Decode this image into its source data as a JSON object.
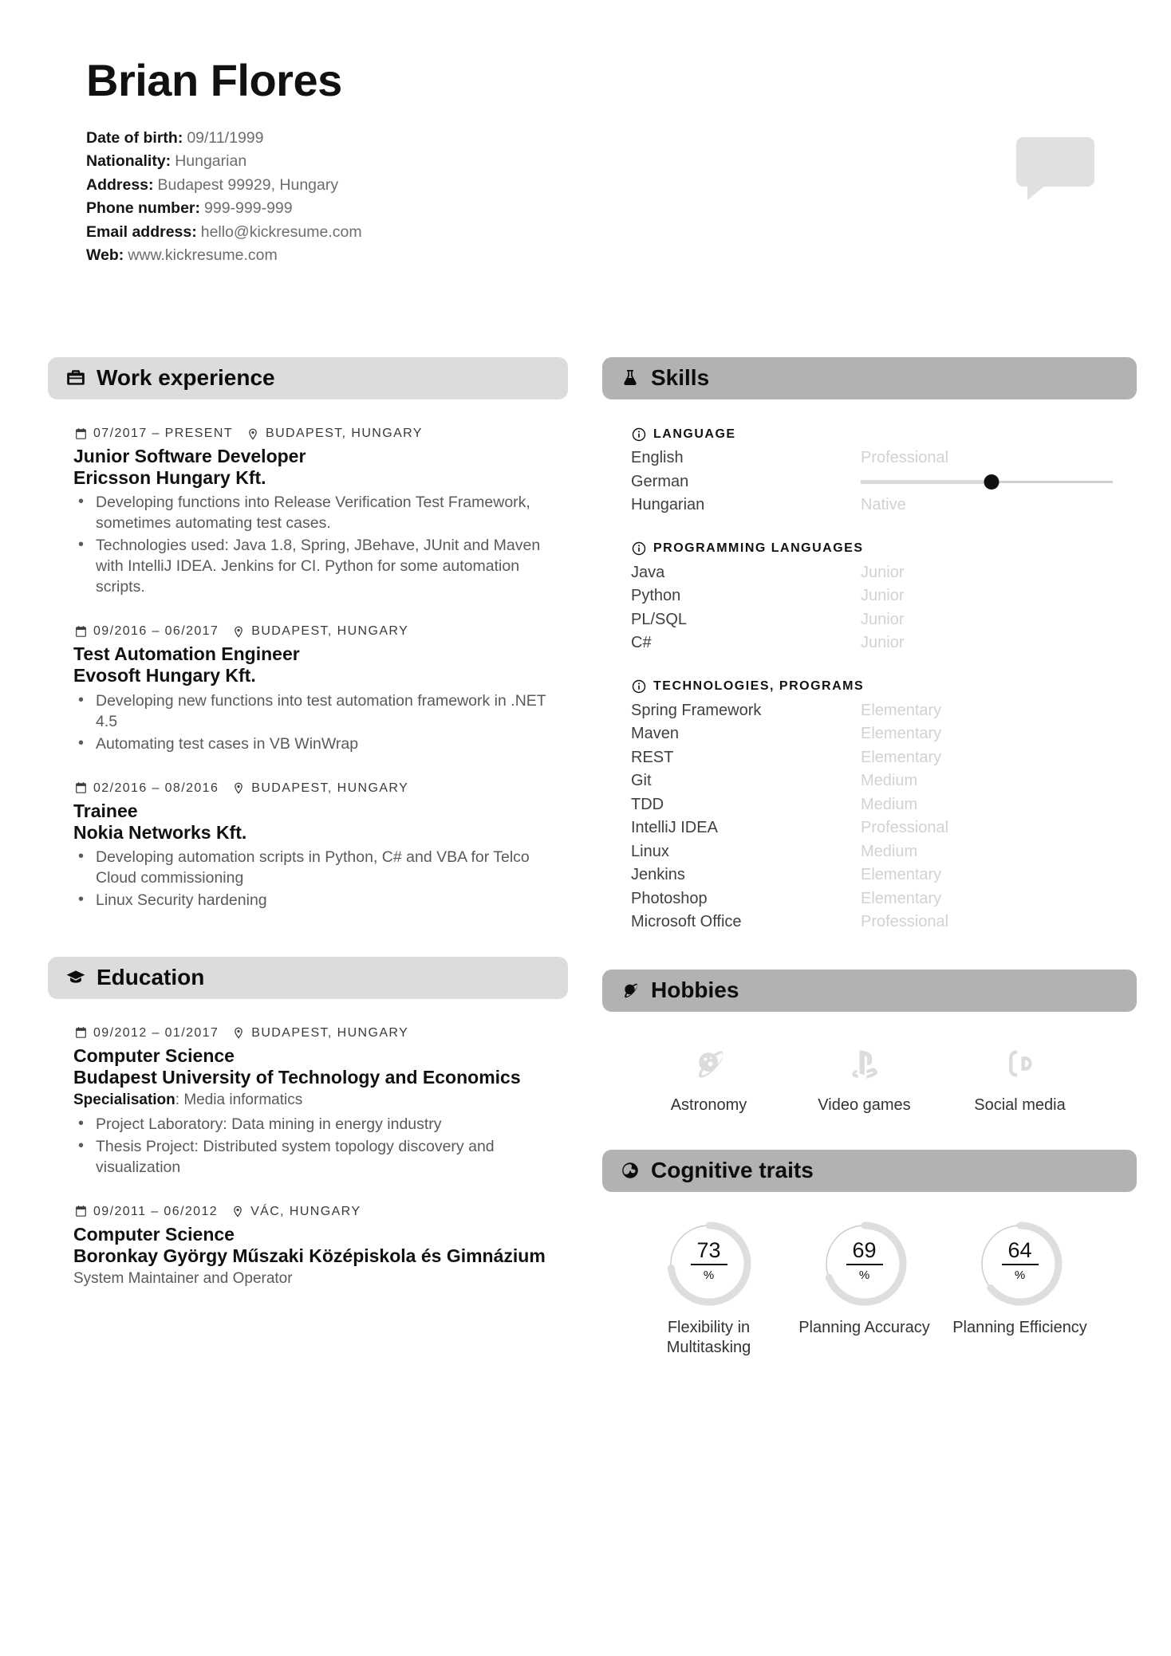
{
  "header": {
    "name": "Brian Flores",
    "contacts": [
      {
        "label": "Date of birth:",
        "value": "09/11/1999"
      },
      {
        "label": "Nationality:",
        "value": "Hungarian"
      },
      {
        "label": "Address:",
        "value": "Budapest 99929, Hungary"
      },
      {
        "label": "Phone number:",
        "value": "999-999-999"
      },
      {
        "label": "Email address:",
        "value": "hello@kickresume.com"
      },
      {
        "label": "Web:",
        "value": "www.kickresume.com"
      }
    ]
  },
  "colors": {
    "section_light": "#dcdcdc",
    "section_dark": "#b2b2b2",
    "level_text": "#d2d2d2",
    "accent_dot": "#111111"
  },
  "work": {
    "title": "Work experience",
    "icon": "briefcase-icon",
    "entries": [
      {
        "dates": "07/2017 – PRESENT",
        "location": "BUDAPEST, HUNGARY",
        "title": "Junior Software Developer",
        "org": "Ericsson Hungary Kft.",
        "bullets": [
          "Developing functions into Release Verification Test Framework, sometimes automating test cases.",
          "Technologies used: Java 1.8, Spring, JBehave, JUnit and Maven with IntelliJ IDEA. Jenkins for CI. Python for some automation scripts."
        ]
      },
      {
        "dates": "09/2016 – 06/2017",
        "location": "BUDAPEST, HUNGARY",
        "title": "Test Automation Engineer",
        "org": "Evosoft Hungary Kft.",
        "bullets": [
          "Developing new functions into test automation framework in .NET 4.5",
          "Automating test cases in VB WinWrap"
        ]
      },
      {
        "dates": "02/2016 – 08/2016",
        "location": "BUDAPEST, HUNGARY",
        "title": "Trainee",
        "org": "Nokia Networks Kft.",
        "bullets": [
          "Developing automation scripts in Python, C# and VBA for Telco Cloud commissioning",
          "Linux Security hardening"
        ]
      }
    ]
  },
  "education": {
    "title": "Education",
    "icon": "graduation-cap-icon",
    "entries": [
      {
        "dates": "09/2012 – 01/2017",
        "location": "BUDAPEST, HUNGARY",
        "title": "Computer Science",
        "org": "Budapest University of Technology and Economics",
        "spec_label": "Specialisation",
        "spec_value": ": Media informatics",
        "bullets": [
          "Project Laboratory: Data mining in energy industry",
          "Thesis Project: Distributed system topology discovery and visualization"
        ]
      },
      {
        "dates": "09/2011 – 06/2012",
        "location": "VÁC, HUNGARY",
        "title": "Computer Science",
        "org": "Boronkay György Műszaki Középiskola és Gimnázium",
        "sub": "System Maintainer and Operator",
        "bullets": []
      }
    ]
  },
  "skills": {
    "title": "Skills",
    "icon": "flask-icon",
    "groups": [
      {
        "name": "LANGUAGE",
        "rows": [
          {
            "name": "English",
            "level": "Professional",
            "slider": null
          },
          {
            "name": "German",
            "level": "",
            "slider": 52
          },
          {
            "name": "Hungarian",
            "level": "Native",
            "slider": null
          }
        ]
      },
      {
        "name": "PROGRAMMING LANGUAGES",
        "rows": [
          {
            "name": "Java",
            "level": "Junior",
            "slider": null
          },
          {
            "name": "Python",
            "level": "Junior",
            "slider": null
          },
          {
            "name": "PL/SQL",
            "level": "Junior",
            "slider": null
          },
          {
            "name": "C#",
            "level": "Junior",
            "slider": null
          }
        ]
      },
      {
        "name": "TECHNOLOGIES, PROGRAMS",
        "rows": [
          {
            "name": "Spring Framework",
            "level": "Elementary",
            "slider": null
          },
          {
            "name": "Maven",
            "level": "Elementary",
            "slider": null
          },
          {
            "name": "REST",
            "level": "Elementary",
            "slider": null
          },
          {
            "name": "Git",
            "level": "Medium",
            "slider": null
          },
          {
            "name": "TDD",
            "level": "Medium",
            "slider": null
          },
          {
            "name": "IntelliJ IDEA",
            "level": "Professional",
            "slider": null
          },
          {
            "name": "Linux",
            "level": "Medium",
            "slider": null
          },
          {
            "name": "Jenkins",
            "level": "Elementary",
            "slider": null
          },
          {
            "name": "Photoshop",
            "level": "Elementary",
            "slider": null
          },
          {
            "name": "Microsoft Office",
            "level": "Professional",
            "slider": null
          }
        ]
      }
    ]
  },
  "hobbies": {
    "title": "Hobbies",
    "icon": "planet-icon",
    "items": [
      {
        "label": "Astronomy",
        "icon": "planet-icon"
      },
      {
        "label": "Video games",
        "icon": "gamepad-icon"
      },
      {
        "label": "Social media",
        "icon": "social-media-icon"
      }
    ]
  },
  "cognitive": {
    "title": "Cognitive traits",
    "icon": "brain-icon",
    "unit": "%",
    "traits": [
      {
        "label": "Flexibility in Multitasking",
        "value": 73
      },
      {
        "label": "Planning Accuracy",
        "value": 69
      },
      {
        "label": "Planning Efficiency",
        "value": 64
      }
    ]
  }
}
